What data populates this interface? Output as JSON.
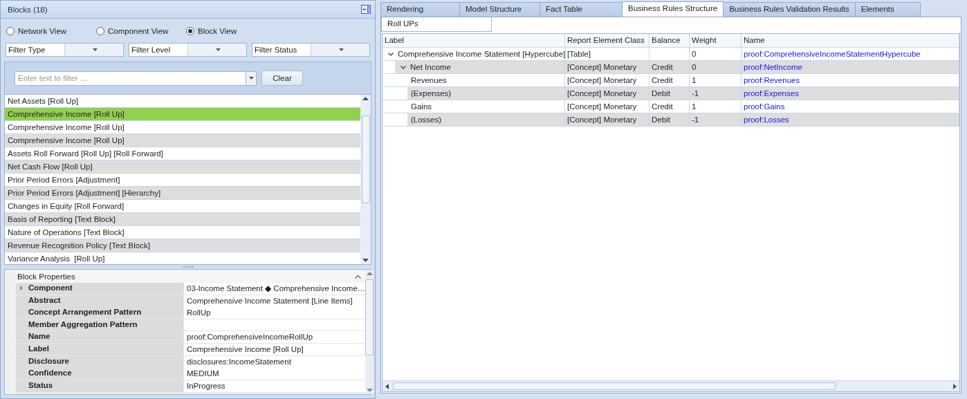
{
  "blocks_panel": {
    "title": "Blocks (18)",
    "views": [
      {
        "label": "Network View",
        "selected": false
      },
      {
        "label": "Component View",
        "selected": false
      },
      {
        "label": "Block View",
        "selected": true
      }
    ],
    "filters": [
      {
        "value": "Filter Type"
      },
      {
        "value": "Filter Level"
      },
      {
        "value": "Filter Status"
      }
    ],
    "search": {
      "placeholder": "Enter text to filter ...",
      "button": "Clear"
    },
    "blocks": [
      {
        "label": "Net Assets [Roll Up]",
        "selected": false
      },
      {
        "label": "Comprehensive Income [Roll Up]",
        "selected": true
      },
      {
        "label": "Comprehensive Income [Roll Up]",
        "selected": false
      },
      {
        "label": "Comprehensive Income [Roll Up]",
        "selected": false
      },
      {
        "label": "Assets Roll Forward [Roll Up] [Roll Forward]",
        "selected": false
      },
      {
        "label": "Net Cash Flow [Roll Up]",
        "selected": false
      },
      {
        "label": "Prior Period Errors [Adjustment]",
        "selected": false
      },
      {
        "label": "Prior Period Errors [Adjustment] [Hierarchy]",
        "selected": false
      },
      {
        "label": "Changes in Equity [Roll Forward]",
        "selected": false
      },
      {
        "label": "Basis of Reporting [Text Block]",
        "selected": false
      },
      {
        "label": "Nature of Operations [Text Block]",
        "selected": false
      },
      {
        "label": "Revenue Recognition Policy [Text Block]",
        "selected": false
      },
      {
        "label": "Variance Analysis  [Roll Up]",
        "selected": false
      }
    ]
  },
  "block_properties": {
    "title": "Block Properties",
    "rows": [
      {
        "name": "Component",
        "value": "03-Income Statement ◆ Comprehensive Income…",
        "expanded": false
      },
      {
        "name": "Abstract",
        "value": "Comprehensive Income Statement [Line Items]"
      },
      {
        "name": "Concept Arrangement Pattern",
        "value": "RollUp"
      },
      {
        "name": "Member Aggregation Pattern"
      },
      {
        "name": "Name",
        "value": "proof:ComprehensiveIncomeRollUp"
      },
      {
        "name": "Label",
        "value": "Comprehensive Income [Roll Up]"
      },
      {
        "name": "Disclosure",
        "value": "disclosures:IncomeStatement"
      },
      {
        "name": "Confidence",
        "value": "MEDIUM"
      },
      {
        "name": "Status",
        "value": "InProgress"
      }
    ]
  },
  "tabs": [
    {
      "label": "Rendering",
      "selected": false
    },
    {
      "label": "Model Structure",
      "selected": false
    },
    {
      "label": "Fact Table",
      "selected": false
    },
    {
      "label": "Business Rules Structure",
      "selected": true
    },
    {
      "label": "Business Rules Validation Results",
      "selected": false
    },
    {
      "label": "Elements",
      "selected": false
    }
  ],
  "sub_tabs": [
    {
      "label": "Roll UPs",
      "selected": true
    }
  ],
  "table": {
    "columns": [
      "Label",
      "Report Element Class",
      "Balance",
      "Weight",
      "Name"
    ],
    "rows": [
      {
        "label": "Comprehensive Income Statement [Hypercube]",
        "class": "[Table]",
        "weight": "0",
        "name": "proof:ComprehensiveIncomeStatementHypercube",
        "expanded": true,
        "children": [
          {
            "label": "Net Income",
            "class": "[Concept] Monetary",
            "balance": "Credit",
            "weight": "0",
            "name": "proof:NetIncome",
            "expanded": true,
            "children": [
              {
                "label": "Revenues",
                "class": "[Concept] Monetary",
                "balance": "Credit",
                "weight": "1",
                "name": "proof:Revenues"
              },
              {
                "label": "(Expenses)",
                "class": "[Concept] Monetary",
                "balance": "Debit",
                "weight": "-1",
                "name": "proof:Expenses"
              },
              {
                "label": "Gains",
                "class": "[Concept] Monetary",
                "balance": "Credit",
                "weight": "1",
                "name": "proof:Gains"
              },
              {
                "label": "(Losses)",
                "class": "[Concept] Monetary",
                "balance": "Debit",
                "weight": "-1",
                "name": "proof:Losses"
              }
            ]
          }
        ]
      }
    ]
  }
}
